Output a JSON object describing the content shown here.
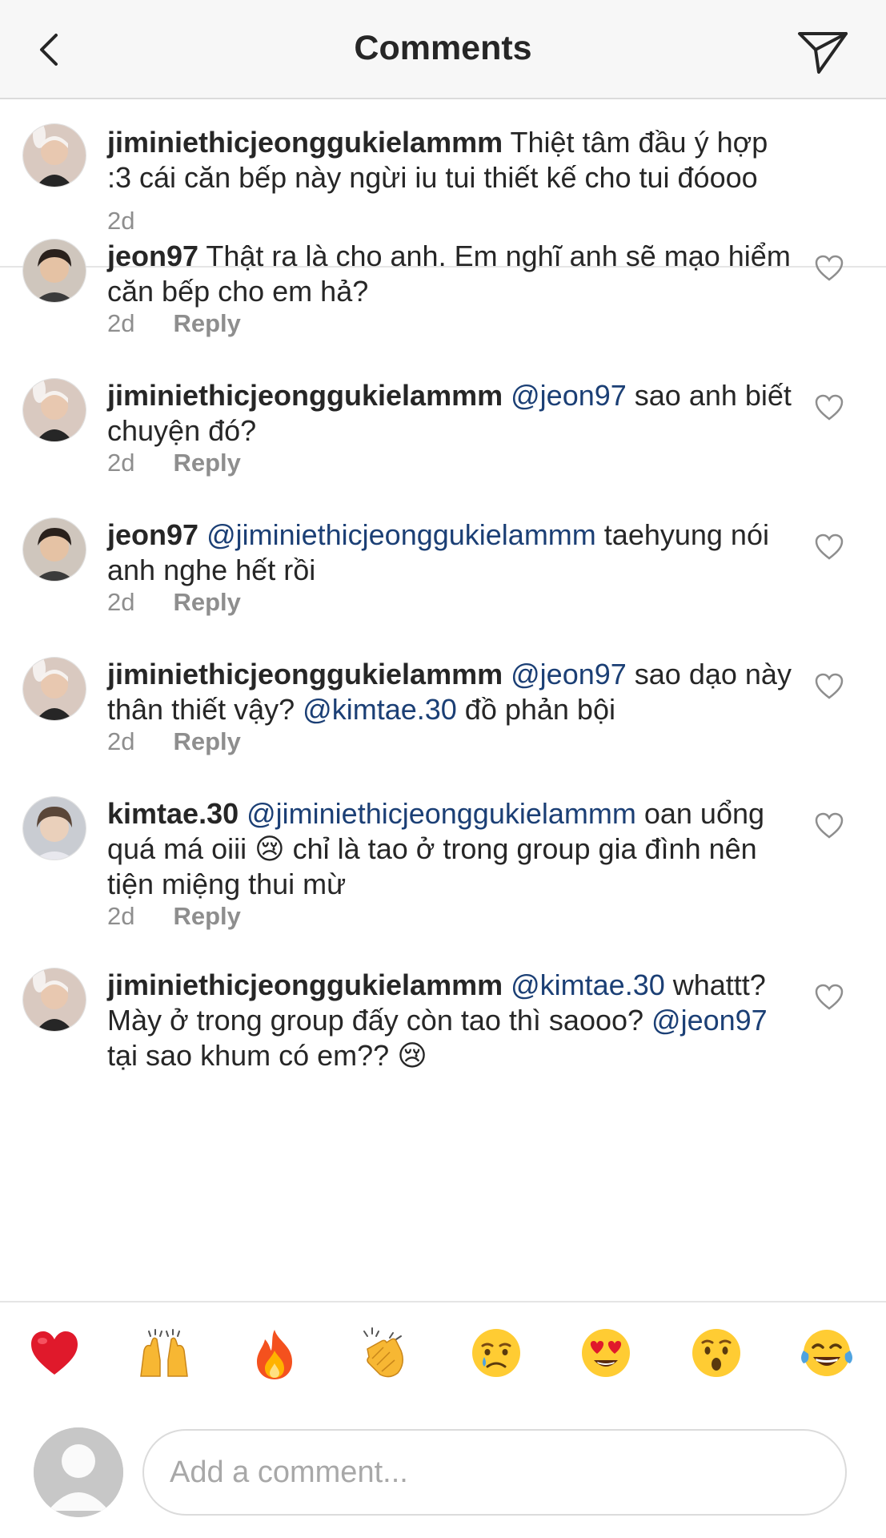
{
  "header": {
    "title": "Comments"
  },
  "caption": {
    "username": "jiminiethicjeonggukielammm",
    "text": " Thiệt tâm đầu ý hợp :3 cái căn bếp này ngừi iu tui thiết kế cho tui đóooo",
    "time": "2d"
  },
  "comments": [
    {
      "username": "jeon97",
      "text_before": " Thật ra là cho anh. Em nghĩ anh sẽ mạo hiểm căn bếp cho em hả?",
      "time": "2d",
      "reply_label": "Reply"
    },
    {
      "username": "jiminiethicjeonggukielammm",
      "mention1": "@jeon97",
      "text_after": " sao anh biết chuyện đó?",
      "time": "2d",
      "reply_label": "Reply"
    },
    {
      "username": "jeon97",
      "mention1": "@jiminiethicjeonggukielammm",
      "text_after": " taehyung nói anh nghe hết rồi",
      "time": "2d",
      "reply_label": "Reply"
    },
    {
      "username": "jiminiethicjeonggukielammm",
      "mention1": "@jeon97",
      "text_mid": " sao dạo này thân thiết vậy? ",
      "mention2": "@kimtae.30",
      "text_after": " đồ phản bội",
      "time": "2d",
      "reply_label": "Reply"
    },
    {
      "username": "kimtae.30",
      "mention1": "@jiminiethicjeonggukielammm",
      "text_mid": " oan uổng quá má oiii ",
      "emoji": "😢",
      "text_after": " chỉ là tao ở trong group gia đình nên tiện miệng thui mừ",
      "time": "2d",
      "reply_label": "Reply"
    },
    {
      "username": "jiminiethicjeonggukielammm",
      "mention1": "@kimtae.30",
      "text_mid": " whattt? Mày ở trong group đấy còn tao thì saooo? ",
      "mention2": "@jeon97",
      "text_after": " tại sao khum có em?? ",
      "emoji": "😢"
    }
  ],
  "emoji_bar": [
    {
      "name": "red-heart",
      "glyph": "❤️"
    },
    {
      "name": "raising-hands",
      "glyph": "🙌"
    },
    {
      "name": "fire",
      "glyph": "🔥"
    },
    {
      "name": "clapping-hands",
      "glyph": "👏"
    },
    {
      "name": "crying-face",
      "glyph": "😢"
    },
    {
      "name": "heart-eyes",
      "glyph": "😍"
    },
    {
      "name": "surprised-face",
      "glyph": "😮"
    },
    {
      "name": "tears-of-joy",
      "glyph": "😂"
    }
  ],
  "composer": {
    "placeholder": "Add a comment..."
  },
  "colors": {
    "mention": "#1b3f75",
    "meta": "#8e8e8e",
    "text": "#262626"
  }
}
